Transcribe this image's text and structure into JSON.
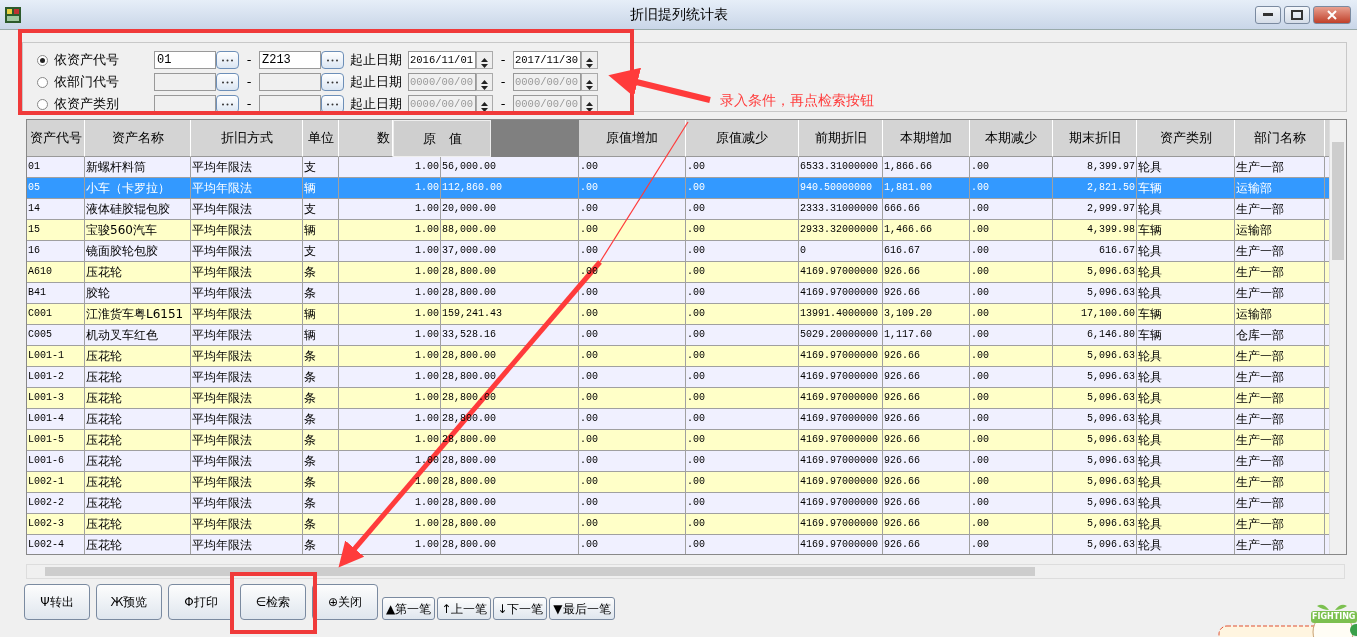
{
  "window": {
    "title": "折旧提列统计表"
  },
  "filters": [
    {
      "label": "依资产代号",
      "selected": true,
      "disabled": false,
      "from": "01",
      "to": "Z213",
      "range_sep": "-",
      "date_label": "起止日期",
      "date_from": "2016/11/01",
      "date_to": "2017/11/30",
      "date_sep": "-"
    },
    {
      "label": "依部门代号",
      "selected": false,
      "disabled": true,
      "range_sep": "-",
      "date_label": "起止日期",
      "date_from": "0000/00/00",
      "date_to": "0000/00/00",
      "date_sep": "-"
    },
    {
      "label": "依资产类别",
      "selected": false,
      "disabled": true,
      "range_sep": "-",
      "date_label": "起止日期",
      "date_from": "0000/00/00",
      "date_to": "0000/00/00",
      "date_sep": "-"
    }
  ],
  "table": {
    "columns": [
      {
        "label": "资产代号",
        "dragging": false
      },
      {
        "label": "资产名称",
        "dragging": false
      },
      {
        "label": "折旧方式",
        "dragging": false
      },
      {
        "label": "单位",
        "dragging": false
      },
      {
        "label": "数",
        "dragging": false
      },
      {
        "label": "原　值",
        "dragging": true
      },
      {
        "label": "原值增加",
        "dragging": false
      },
      {
        "label": "原值减少",
        "dragging": false
      },
      {
        "label": "前期折旧",
        "dragging": false
      },
      {
        "label": "本期增加",
        "dragging": false
      },
      {
        "label": "本期减少",
        "dragging": false
      },
      {
        "label": "期末折旧",
        "dragging": false
      },
      {
        "label": "资产类别",
        "dragging": false
      },
      {
        "label": "部门名称",
        "dragging": false
      }
    ],
    "rows": [
      {
        "selected": false,
        "cells": [
          "01",
          "新螺杆料筒",
          "平均年限法",
          "支",
          "1.00",
          "56,000.00",
          ".00",
          ".00",
          "6533.31000000",
          "1,866.66",
          ".00",
          "8,399.97",
          "轮具",
          "生产一部"
        ]
      },
      {
        "selected": true,
        "cells": [
          "05",
          "小车（卡罗拉）",
          "平均年限法",
          "辆",
          "1.00",
          "112,860.00",
          ".00",
          ".00",
          "940.50000000",
          "1,881.00",
          ".00",
          "2,821.50",
          "车辆",
          "运输部"
        ]
      },
      {
        "selected": false,
        "cells": [
          "14",
          "液体硅胶辊包胶",
          "平均年限法",
          "支",
          "1.00",
          "20,000.00",
          ".00",
          ".00",
          "2333.31000000",
          "666.66",
          ".00",
          "2,999.97",
          "轮具",
          "生产一部"
        ]
      },
      {
        "selected": false,
        "cells": [
          "15",
          "宝骏560汽车",
          "平均年限法",
          "辆",
          "1.00",
          "88,000.00",
          ".00",
          ".00",
          "2933.32000000",
          "1,466.66",
          ".00",
          "4,399.98",
          "车辆",
          "运输部"
        ]
      },
      {
        "selected": false,
        "cells": [
          "16",
          "镜面胶轮包胶",
          "平均年限法",
          "支",
          "1.00",
          "37,000.00",
          ".00",
          ".00",
          "0",
          "616.67",
          ".00",
          "616.67",
          "轮具",
          "生产一部"
        ]
      },
      {
        "selected": false,
        "cells": [
          "A610",
          "压花轮",
          "平均年限法",
          "条",
          "1.00",
          "28,800.00",
          ".00",
          ".00",
          "4169.97000000",
          "926.66",
          ".00",
          "5,096.63",
          "轮具",
          "生产一部"
        ]
      },
      {
        "selected": false,
        "cells": [
          "B41",
          "胶轮",
          "平均年限法",
          "条",
          "1.00",
          "28,800.00",
          ".00",
          ".00",
          "4169.97000000",
          "926.66",
          ".00",
          "5,096.63",
          "轮具",
          "生产一部"
        ]
      },
      {
        "selected": false,
        "cells": [
          "C001",
          "江淮货车粤L6151",
          "平均年限法",
          "辆",
          "1.00",
          "159,241.43",
          ".00",
          ".00",
          "13991.4000000",
          "3,109.20",
          ".00",
          "17,100.60",
          "车辆",
          "运输部"
        ]
      },
      {
        "selected": false,
        "cells": [
          "C005",
          "机动叉车红色",
          "平均年限法",
          "辆",
          "1.00",
          "33,528.16",
          ".00",
          ".00",
          "5029.20000000",
          "1,117.60",
          ".00",
          "6,146.80",
          "车辆",
          "仓库一部"
        ]
      },
      {
        "selected": false,
        "cells": [
          "L001-1",
          "压花轮",
          "平均年限法",
          "条",
          "1.00",
          "28,800.00",
          ".00",
          ".00",
          "4169.97000000",
          "926.66",
          ".00",
          "5,096.63",
          "轮具",
          "生产一部"
        ]
      },
      {
        "selected": false,
        "cells": [
          "L001-2",
          "压花轮",
          "平均年限法",
          "条",
          "1.00",
          "28,800.00",
          ".00",
          ".00",
          "4169.97000000",
          "926.66",
          ".00",
          "5,096.63",
          "轮具",
          "生产一部"
        ]
      },
      {
        "selected": false,
        "cells": [
          "L001-3",
          "压花轮",
          "平均年限法",
          "条",
          "1.00",
          "28,800.00",
          ".00",
          ".00",
          "4169.97000000",
          "926.66",
          ".00",
          "5,096.63",
          "轮具",
          "生产一部"
        ]
      },
      {
        "selected": false,
        "cells": [
          "L001-4",
          "压花轮",
          "平均年限法",
          "条",
          "1.00",
          "28,800.00",
          ".00",
          ".00",
          "4169.97000000",
          "926.66",
          ".00",
          "5,096.63",
          "轮具",
          "生产一部"
        ]
      },
      {
        "selected": false,
        "cells": [
          "L001-5",
          "压花轮",
          "平均年限法",
          "条",
          "1.00",
          "28,800.00",
          ".00",
          ".00",
          "4169.97000000",
          "926.66",
          ".00",
          "5,096.63",
          "轮具",
          "生产一部"
        ]
      },
      {
        "selected": false,
        "cells": [
          "L001-6",
          "压花轮",
          "平均年限法",
          "条",
          "1.00",
          "28,800.00",
          ".00",
          ".00",
          "4169.97000000",
          "926.66",
          ".00",
          "5,096.63",
          "轮具",
          "生产一部"
        ]
      },
      {
        "selected": false,
        "cells": [
          "L002-1",
          "压花轮",
          "平均年限法",
          "条",
          "1.00",
          "28,800.00",
          ".00",
          ".00",
          "4169.97000000",
          "926.66",
          ".00",
          "5,096.63",
          "轮具",
          "生产一部"
        ]
      },
      {
        "selected": false,
        "cells": [
          "L002-2",
          "压花轮",
          "平均年限法",
          "条",
          "1.00",
          "28,800.00",
          ".00",
          ".00",
          "4169.97000000",
          "926.66",
          ".00",
          "5,096.63",
          "轮具",
          "生产一部"
        ]
      },
      {
        "selected": false,
        "cells": [
          "L002-3",
          "压花轮",
          "平均年限法",
          "条",
          "1.00",
          "28,800.00",
          ".00",
          ".00",
          "4169.97000000",
          "926.66",
          ".00",
          "5,096.63",
          "轮具",
          "生产一部"
        ]
      },
      {
        "selected": false,
        "cells": [
          "L002-4",
          "压花轮",
          "平均年限法",
          "条",
          "1.00",
          "28,800.00",
          ".00",
          ".00",
          "4169.97000000",
          "926.66",
          ".00",
          "5,096.63",
          "轮具",
          "生产一部"
        ]
      }
    ]
  },
  "buttons": [
    {
      "kind": "main",
      "glyph": "Ψ",
      "label": "转出"
    },
    {
      "kind": "main",
      "glyph": "Ж",
      "label": "预览"
    },
    {
      "kind": "main",
      "glyph": "Φ",
      "label": "打印"
    },
    {
      "kind": "main",
      "glyph": "∈",
      "label": "检索"
    },
    {
      "kind": "main",
      "glyph": "⊕",
      "label": "关闭"
    },
    {
      "kind": "nav",
      "glyph": "▲",
      "label": "第一笔"
    },
    {
      "kind": "nav",
      "glyph": "↑",
      "label": "上一笔"
    },
    {
      "kind": "nav",
      "glyph": "↓",
      "label": "下一笔"
    },
    {
      "kind": "nav",
      "glyph": "▼",
      "label": "最后一笔"
    }
  ],
  "annotation": {
    "text": "录入条件，再点检索按钮"
  },
  "sticker": {
    "text": "FIGHTING"
  }
}
